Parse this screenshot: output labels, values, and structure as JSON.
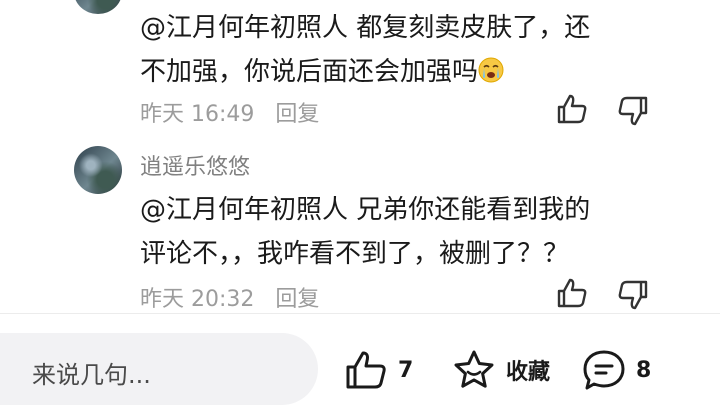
{
  "comments": [
    {
      "text_line1": "@江月何年初照人  都复刻卖皮肤了，还",
      "text_line2": "不加强，你说后面还会加强吗",
      "time": "昨天 16:49",
      "reply_label": "回复"
    },
    {
      "username": "逍遥乐悠悠",
      "text_line1": "@江月何年初照人  兄弟你还能看到我的",
      "text_line2": "评论不，，我咋看不到了，被删了？？",
      "time": "昨天 20:32",
      "reply_label": "回复"
    }
  ],
  "bottom_bar": {
    "input_placeholder": "来说几句...",
    "like_count": "7",
    "favorite_label": "收藏",
    "comment_count": "8"
  },
  "icons": {
    "thumb_up": "thumb-up-icon",
    "thumb_down": "thumb-down-icon",
    "star": "star-icon",
    "comment": "comment-bubble-icon",
    "emoji": "crying-face-emoji"
  },
  "colors": {
    "text": "#1a1a1a",
    "meta": "#9c9c9c",
    "username": "#808080",
    "input_bg": "#f2f2f4"
  }
}
